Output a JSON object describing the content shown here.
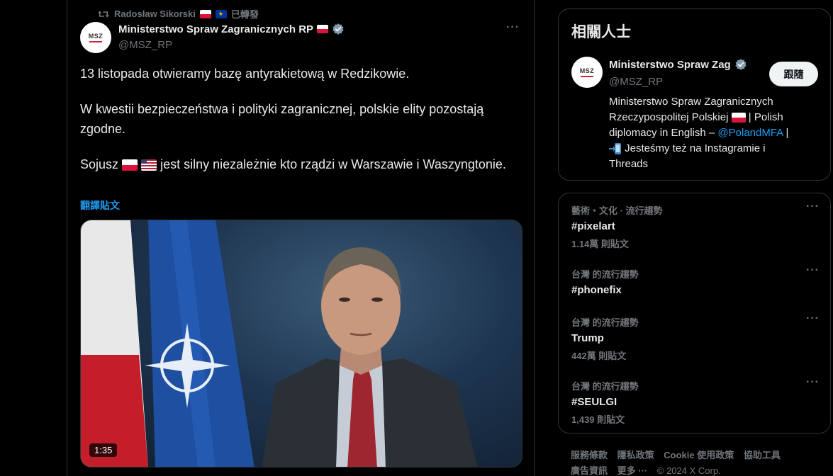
{
  "retweet": {
    "user": "Radosław Sikorski",
    "label": "已轉發"
  },
  "tweet": {
    "author_name": "Ministerstwo Spraw Zagranicznych RP",
    "handle": "@MSZ_RP",
    "avatar_text": "MSZ",
    "paragraph1": "13 listopada otwieramy bazę antyrakietową w Redzikowie.",
    "paragraph2": "W kwestii bezpieczeństwa i polityki zagranicznej, polskie elity pozostają zgodne.",
    "paragraph3_before": "Sojusz",
    "paragraph3_after": "jest silny niezależnie kto rządzi w Warszawie i Waszyngtonie.",
    "translate_label": "翻譯貼文",
    "video_duration": "1:35"
  },
  "people": {
    "title": "相關人士",
    "name": "Ministerstwo Spraw Zag",
    "handle": "@MSZ_RP",
    "avatar_text": "MSZ",
    "follow_label": "跟隨",
    "bio_line1": "Ministerstwo Spraw Zagranicznych",
    "bio_line2": "Rzeczypospolitej Polskiej",
    "bio_line2_after": "| Polish",
    "bio_line3": "diplomacy in English –",
    "bio_link": "@PolandMFA",
    "bio_line3_after": "|",
    "bio_line4": "Jesteśmy też na Instagramie i",
    "bio_line5": "Threads"
  },
  "trends": [
    {
      "context": "藝術・文化 · 流行趨勢",
      "name": "#pixelart",
      "count": "1.14萬 則貼文"
    },
    {
      "context": "台灣 的流行趨勢",
      "name": "#phonefix",
      "count": ""
    },
    {
      "context": "台灣 的流行趨勢",
      "name": "Trump",
      "count": "442萬 則貼文"
    },
    {
      "context": "台灣 的流行趨勢",
      "name": "#SEULGI",
      "count": "1,439 則貼文"
    }
  ],
  "footer": {
    "terms": "服務條款",
    "privacy": "隱私政策",
    "cookie": "Cookie 使用政策",
    "accessibility": "協助工具",
    "ads": "廣告資訊",
    "more": "更多 ···",
    "copyright": "© 2024 X Corp."
  },
  "colors": {
    "accent": "#1d9bf0",
    "background": "#000000",
    "muted": "#71767b",
    "border": "#2f3336"
  },
  "icons": [
    "retweet-icon",
    "verified-icon",
    "more-icon",
    "phone-arrow-icon"
  ]
}
